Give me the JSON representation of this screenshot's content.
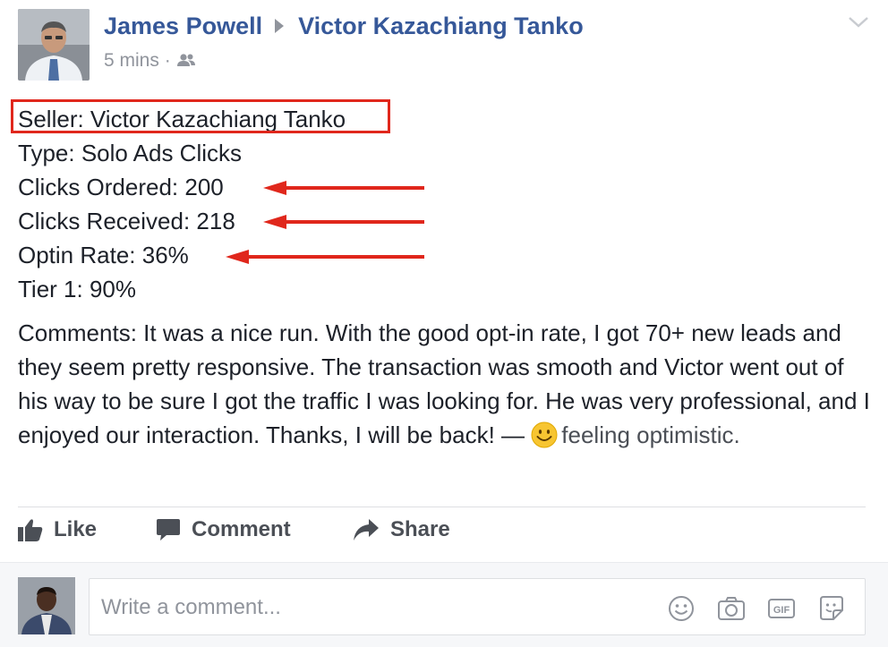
{
  "post": {
    "author": "James Powell",
    "target": "Victor Kazachiang Tanko",
    "time": "5 mins",
    "separator": "·",
    "privacy_icon": "friends-icon",
    "menu_icon": "chevron-down-icon"
  },
  "details": {
    "seller": "Seller: Victor Kazachiang Tanko",
    "type": "Type: Solo Ads Clicks",
    "clicks_ordered": "Clicks Ordered: 200",
    "clicks_received": "Clicks Received: 218",
    "optin_rate": "Optin Rate: 36%",
    "tier": "Tier 1: 90%"
  },
  "annotations": {
    "box_color": "#e0271c",
    "arrow_color": "#e0271c"
  },
  "comment": {
    "text": "Comments: It was a nice run. With the good opt-in rate, I got 70+ new leads and they seem pretty responsive. The transaction was smooth and Victor went out of his way to be sure I got the traffic I was looking for. He was very professional, and I enjoyed our interaction. Thanks, I will be back! —",
    "feeling": "feeling optimistic.",
    "feeling_icon": "smiley-emoji-icon"
  },
  "actions": {
    "like": "Like",
    "comment": "Comment",
    "share": "Share"
  },
  "composer": {
    "placeholder": "Write a comment...",
    "icons": [
      "emoji-icon",
      "camera-icon",
      "gif-icon",
      "sticker-icon"
    ]
  },
  "colors": {
    "link": "#365899",
    "muted": "#90949c",
    "text": "#1d2129"
  }
}
